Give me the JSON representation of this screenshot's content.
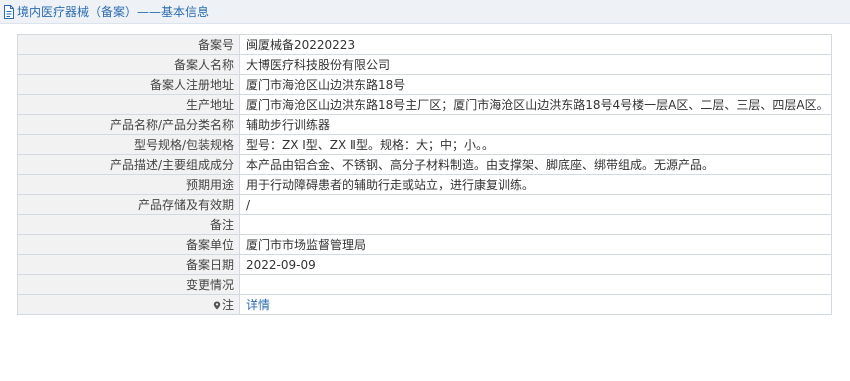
{
  "header": {
    "title": "境内医疗器械（备案）——基本信息"
  },
  "rows": [
    {
      "label": "备案号",
      "value": "闽厦械备20220223"
    },
    {
      "label": "备案人名称",
      "value": "大博医疗科技股份有限公司"
    },
    {
      "label": "备案人注册地址",
      "value": "厦门市海沧区山边洪东路18号"
    },
    {
      "label": "生产地址",
      "value": "厦门市海沧区山边洪东路18号主厂区；厦门市海沧区山边洪东路18号4号楼一层A区、二层、三层、四层A区。"
    },
    {
      "label": "产品名称/产品分类名称",
      "value": "辅助步行训练器"
    },
    {
      "label": "型号规格/包装规格",
      "value": "型号：ZX Ⅰ型、ZX Ⅱ型。规格：大；中；小。。"
    },
    {
      "label": "产品描述/主要组成成分",
      "value": "本产品由铝合金、不锈钢、高分子材料制造。由支撑架、脚底座、绑带组成。无源产品。"
    },
    {
      "label": "预期用途",
      "value": "用于行动障碍患者的辅助行走或站立，进行康复训练。"
    },
    {
      "label": "产品存储及有效期",
      "value": "/"
    },
    {
      "label": "备注",
      "value": ""
    },
    {
      "label": "备案单位",
      "value": "厦门市市场监督管理局"
    },
    {
      "label": "备案日期",
      "value": "2022-09-09"
    },
    {
      "label": "变更情况",
      "value": ""
    }
  ],
  "note_row": {
    "label": "注",
    "link": "详情"
  }
}
